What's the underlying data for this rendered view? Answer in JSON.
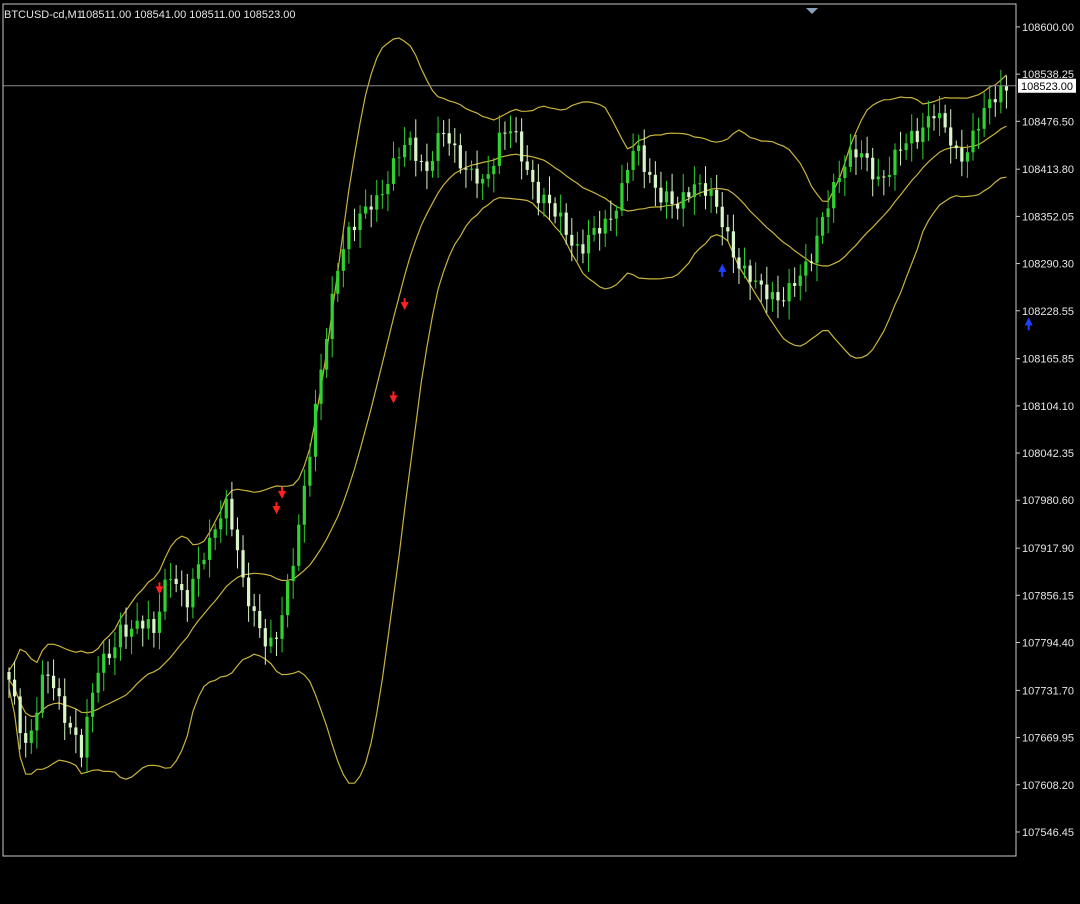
{
  "header": {
    "symbol": "BTCUSD-cd,M1",
    "ohlc": "108511.00 108541.00 108511.00 108523.00"
  },
  "colors": {
    "background": "#000000",
    "frame": "#c8c8c8",
    "bull_candle": "#2fd22f",
    "bear_candle": "#d8f5c8",
    "bollinger": "#c8b43c",
    "sell_arrow": "#ff2020",
    "buy_arrow": "#2040ff",
    "current_price_line": "#8a8a8a",
    "axis_text": "#e6e6e6"
  },
  "chart_data": {
    "type": "candlestick",
    "timeframe": "M1",
    "grid": false,
    "ylim": [
      107515,
      108630
    ],
    "y_ticks": [
      "108600.00",
      "108538.25",
      "108476.50",
      "108413.80",
      "108352.05",
      "108290.30",
      "108228.55",
      "108165.85",
      "108104.10",
      "108042.35",
      "107980.60",
      "107917.90",
      "107856.15",
      "107794.40",
      "107731.70",
      "107669.95",
      "107608.20",
      "107546.45"
    ],
    "current_price": "108523.00",
    "close_samples": [
      107740,
      107700,
      107660,
      107690,
      107740,
      107750,
      107720,
      107700,
      107680,
      107650,
      107700,
      107760,
      107780,
      107790,
      107810,
      107800,
      107820,
      107830,
      107810,
      107850,
      107880,
      107870,
      107850,
      107880,
      107900,
      107920,
      107960,
      107980,
      107940,
      107870,
      107840,
      107820,
      107800,
      107790,
      107830,
      107880,
      107950,
      108020,
      108090,
      108160,
      108230,
      108300,
      108330,
      108340,
      108350,
      108370,
      108380,
      108400,
      108420,
      108440,
      108450,
      108430,
      108410,
      108440,
      108460,
      108450,
      108430,
      108410,
      108400,
      108390,
      108420,
      108460,
      108470,
      108450,
      108420,
      108400,
      108380,
      108370,
      108350,
      108340,
      108320,
      108310,
      108320,
      108330,
      108340,
      108360,
      108380,
      108420,
      108440,
      108420,
      108400,
      108380,
      108370,
      108360,
      108380,
      108400,
      108390,
      108380,
      108360,
      108340,
      108310,
      108280,
      108270,
      108260,
      108260,
      108250,
      108240,
      108250,
      108270,
      108290,
      108310,
      108340,
      108370,
      108400,
      108430,
      108440,
      108430,
      108410,
      108400,
      108410,
      108430,
      108440,
      108450,
      108460,
      108480,
      108490,
      108470,
      108450,
      108430,
      108440,
      108460,
      108480,
      108500,
      108520,
      108523
    ],
    "signals": [
      {
        "type": "sell",
        "index": 19,
        "price": 107860
      },
      {
        "type": "sell",
        "index": 33,
        "price": 107965
      },
      {
        "type": "sell",
        "index": 34,
        "price": 107985
      },
      {
        "type": "sell",
        "index": 48,
        "price": 108110
      },
      {
        "type": "sell",
        "index": 49,
        "price": 108232
      },
      {
        "type": "buy",
        "index": 89,
        "price": 108282
      },
      {
        "type": "buy",
        "index": 127,
        "price": 108212
      }
    ],
    "bollinger_bands": {
      "upper": "upper band",
      "middle": "middle band",
      "lower": "lower band"
    }
  }
}
